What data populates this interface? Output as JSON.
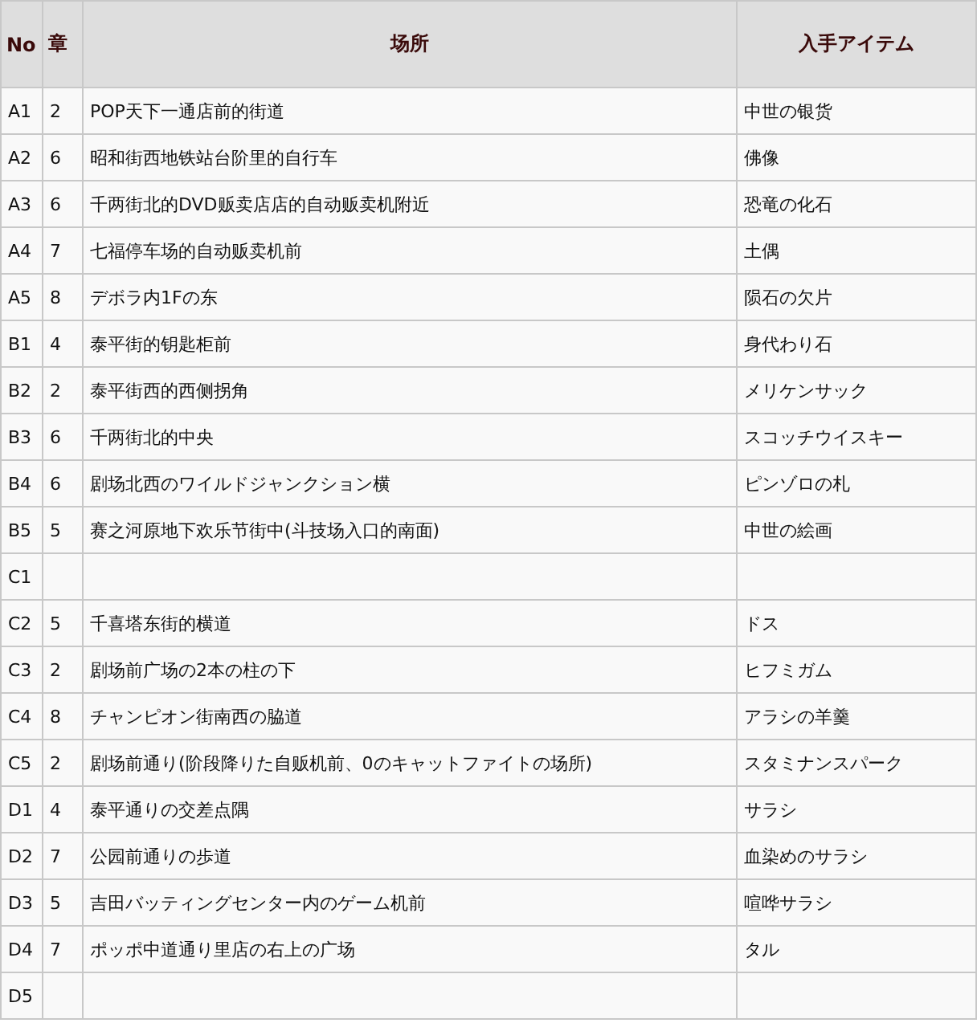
{
  "table": {
    "columns": [
      "No",
      "章",
      "场所",
      "入手アイテム"
    ],
    "rows": [
      {
        "no": "A1",
        "chapter": "2",
        "place": "POP天下一通店前的街道",
        "item": "中世の银货"
      },
      {
        "no": "A2",
        "chapter": "6",
        "place": "昭和街西地铁站台阶里的自行车",
        "item": "佛像"
      },
      {
        "no": "A3",
        "chapter": "6",
        "place": "千两街北的DVD贩卖店店的自动贩卖机附近",
        "item": "恐竜の化石"
      },
      {
        "no": "A4",
        "chapter": "7",
        "place": "七福停车场的自动贩卖机前",
        "item": "土偶"
      },
      {
        "no": "A5",
        "chapter": "8",
        "place": "デボラ内1Fの东",
        "item": "陨石の欠片"
      },
      {
        "no": "B1",
        "chapter": "4",
        "place": "泰平街的钥匙柜前",
        "item": "身代わり石"
      },
      {
        "no": "B2",
        "chapter": "2",
        "place": "泰平街西的西侧拐角",
        "item": "メリケンサック"
      },
      {
        "no": "B3",
        "chapter": "6",
        "place": "千两街北的中央",
        "item": "スコッチウイスキー"
      },
      {
        "no": "B4",
        "chapter": "6",
        "place": "剧场北西のワイルドジャンクション横",
        "item": "ピンゾロの札"
      },
      {
        "no": "B5",
        "chapter": "5",
        "place": "赛之河原地下欢乐节街中(斗技场入口的南面)",
        "item": "中世の絵画"
      },
      {
        "no": "C1"
      },
      {
        "no": "C2",
        "chapter": "5",
        "place": "千喜塔东街的横道",
        "item": "ドス"
      },
      {
        "no": "C3",
        "chapter": "2",
        "place": "剧场前广场の2本の柱の下",
        "item": "ヒフミガム"
      },
      {
        "no": "C4",
        "chapter": "8",
        "place": "チャンピオン街南西の脇道",
        "item": "アラシの羊羹"
      },
      {
        "no": "C5",
        "chapter": "2",
        "place": "剧场前通り(阶段降りた自贩机前、0のキャットファイトの场所)",
        "item": "スタミナンスパーク"
      },
      {
        "no": "D1",
        "chapter": "4",
        "place": "泰平通りの交差点隅",
        "item": "サラシ"
      },
      {
        "no": "D2",
        "chapter": "7",
        "place": "公园前通りの歩道",
        "item": "血染めのサラシ"
      },
      {
        "no": "D3",
        "chapter": "5",
        "place": "吉田バッティングセンター内のゲーム机前",
        "item": "喧哗サラシ"
      },
      {
        "no": "D4",
        "chapter": "7",
        "place": "ポッポ中道通り里店の右上の广场",
        "item": "タル"
      },
      {
        "no": "D5"
      }
    ]
  }
}
